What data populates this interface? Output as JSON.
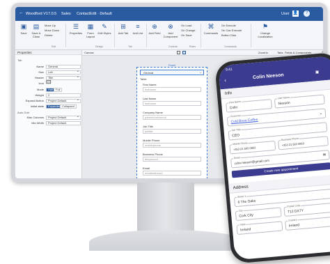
{
  "app": {
    "title": "Woodford V17.0.5",
    "tab_sales": "Sales",
    "breadcrumb": "ContactEdit · Default",
    "user": "User"
  },
  "ribbon": {
    "save": "Save",
    "save_close": "Save & Close",
    "move_up": "Move Up",
    "move_down": "Move Down",
    "delete": "Delete",
    "properties": "Properties",
    "form_layout": "Form Layout",
    "edit_styles": "Edit Styles",
    "add_tab": "Add Tab",
    "add_list": "Add List",
    "add_field": "Add Field",
    "add_component": "Add Component",
    "on_load": "On Load",
    "on_change": "On Change",
    "on_save": "On Save",
    "commands": "Commands",
    "on_execute": "On Execute",
    "on_can_execute": "On Can Execute",
    "button_click": "Button Click",
    "change_localization": "Change Localization",
    "grp_edit": "Edit",
    "grp_design": "Design",
    "grp_tab": "Tab",
    "grp_controls": "Controls",
    "grp_rules": "Rules",
    "grp_commands": "Commands"
  },
  "properties": {
    "header": "Properties",
    "section_tab": "Tab",
    "name_label": "Name",
    "name_value": "General",
    "size_label": "Size",
    "size_value": "Left",
    "header_label": "Header",
    "header_value": "Title",
    "icon_label": "Icon",
    "mode_label": "Mode",
    "mode_half": "Half",
    "mode_full": "Full",
    "weight_label": "Weight",
    "weight_value": "2",
    "expand_label": "Expand Button",
    "expand_value": "Project Default",
    "initial_label": "Initial state",
    "initial_expanded": "Expanded",
    "initial_collapsed": "Collapsed",
    "section_grid": "Auto Grid",
    "maxcol_label": "Max Columns",
    "maxcol_value": "Project Default",
    "minwidth_label": "Min Width",
    "minwidth_value": "Project Default"
  },
  "canvas": {
    "label": "Canvas",
    "zoom": "Zoom",
    "zoom_value": "1x",
    "tabs_label": "Tabs",
    "tabs_value": "Fields & Components",
    "panel": "Panel",
    "general": "General",
    "table": "Table"
  },
  "form_fields": [
    {
      "label": "First Name",
      "placeholder": "firstname"
    },
    {
      "label": "Last Name",
      "placeholder": "lastname"
    },
    {
      "label": "Company Name",
      "placeholder": "parentcustomerid"
    },
    {
      "label": "Job Title",
      "placeholder": "jobtitle"
    },
    {
      "label": "Mobile Phone",
      "placeholder": "mobilephone"
    },
    {
      "label": "Business Phone",
      "placeholder": "telephone1"
    },
    {
      "label": "Email",
      "placeholder": "emailaddress1"
    }
  ],
  "phone": {
    "time": "9:41",
    "contact_name": "Colin Neeson",
    "info": "Info",
    "first_name_label": "First Name",
    "first_name": "Colin",
    "last_name_label": "Last Name",
    "last_name": "Neeson",
    "customer_label": "Customer",
    "customer": "Cold Brew Coffee",
    "job_title_label": "Job Title",
    "job_title": "CEO",
    "mobile_label": "Mobile Phone",
    "mobile": "+353 21 583 0863",
    "business_label": "Business Phone",
    "business": "+353 21 583 0863",
    "email_label": "Email",
    "email": "colin.neeson@gmail.com",
    "appointment": "Create new appointment",
    "address": "Address",
    "street_label": "Street 1",
    "street": "6 The Oaks",
    "city_label": "City",
    "city": "Cork City",
    "postal_label": "Postal Code",
    "postal": "T12 DX7Y",
    "state_label": "State",
    "state": "Ireland",
    "country_label": "Country",
    "country": "Ireland"
  },
  "colors": {
    "accent": "#2a5aa0",
    "phone_header": "#3b3b8f",
    "canvas_bg": "#e7e9ec"
  }
}
